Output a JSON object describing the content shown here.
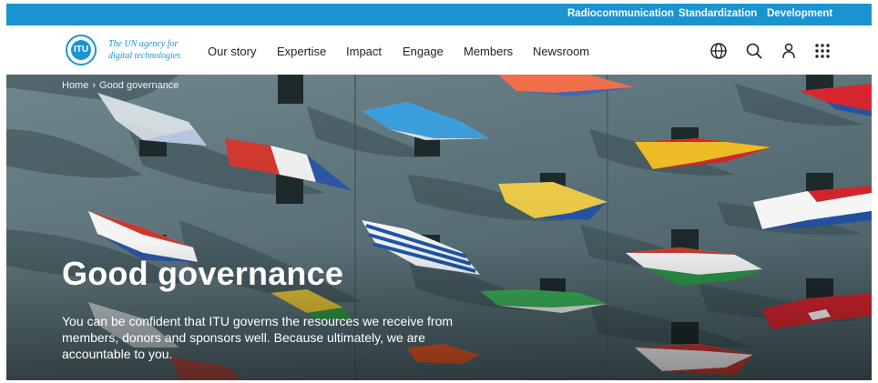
{
  "sectors": [
    "Radiocommunication",
    "Standardization",
    "Development"
  ],
  "logo": {
    "badge_text": "ITU",
    "tagline_line1": "The UN agency for",
    "tagline_line2": "digital technologies"
  },
  "nav": [
    "Our story",
    "Expertise",
    "Impact",
    "Engage",
    "Members",
    "Newsroom"
  ],
  "icons": [
    "globe-icon",
    "search-icon",
    "user-icon",
    "apps-grid-icon"
  ],
  "breadcrumb": {
    "home": "Home",
    "separator": "›",
    "current": "Good governance"
  },
  "hero": {
    "title": "Good governance",
    "text": "You can be confident that ITU governs the resources we receive from members, donors and sponsors well. Because ultimately, we are accountable to you."
  },
  "colors": {
    "brand_blue": "#1a94d0",
    "hero_wall": "#5b7279"
  }
}
